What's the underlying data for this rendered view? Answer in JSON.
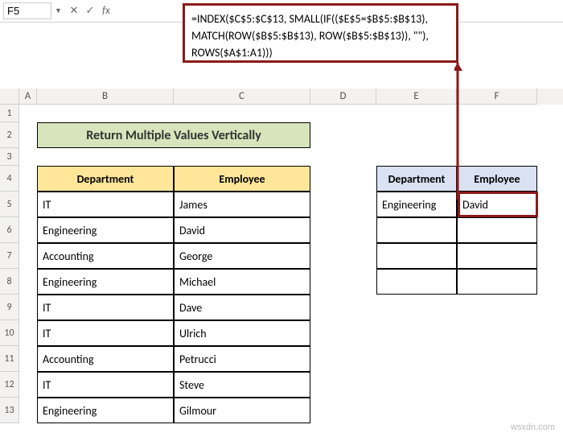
{
  "formula_bar": {
    "name_box": "F5",
    "cancel": "✕",
    "confirm": "✓",
    "fx": "fx",
    "formula_line1": "=INDEX($C$5:$C$13, SMALL(IF(($E$5=$B$5:$B$13),",
    "formula_line2": " MATCH(ROW($B$5:$B$13), ROW($B$5:$B$13)), \"\"),",
    "formula_line3": "ROWS($A$1:A1)))"
  },
  "columns": {
    "A": "A",
    "B": "B",
    "C": "C",
    "D": "D",
    "E": "E",
    "F": "F"
  },
  "row_labels": [
    "1",
    "2",
    "3",
    "4",
    "5",
    "6",
    "7",
    "8",
    "9",
    "10",
    "11",
    "12",
    "13"
  ],
  "title": "Return Multiple Values Vertically",
  "left_table": {
    "headers": {
      "dept": "Department",
      "emp": "Employee"
    },
    "rows": [
      {
        "dept": "IT",
        "emp": "James"
      },
      {
        "dept": "Engineering",
        "emp": "David"
      },
      {
        "dept": "Accounting",
        "emp": "George"
      },
      {
        "dept": "Engineering",
        "emp": "Michael"
      },
      {
        "dept": "IT",
        "emp": "Dave"
      },
      {
        "dept": "IT",
        "emp": "Ulrich"
      },
      {
        "dept": "Accounting",
        "emp": "Petrucci"
      },
      {
        "dept": "IT",
        "emp": "Steve"
      },
      {
        "dept": "Engineering",
        "emp": "Gilmour"
      }
    ]
  },
  "right_table": {
    "headers": {
      "dept": "Department",
      "emp": "Employee"
    },
    "rows": [
      {
        "dept": "Engineering",
        "emp": "David"
      },
      {
        "dept": "",
        "emp": ""
      },
      {
        "dept": "",
        "emp": ""
      },
      {
        "dept": "",
        "emp": ""
      }
    ]
  },
  "watermark": "wsxdn.com"
}
